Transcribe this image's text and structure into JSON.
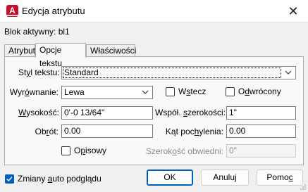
{
  "window": {
    "title": "Edycja atrybutu",
    "app_icon": "A",
    "close_icon": "close-icon"
  },
  "block_label": "Blok aktywny: bl1",
  "tabs": [
    {
      "label": "Atrybut",
      "active": false
    },
    {
      "label": "Opcje tekstu",
      "active": true
    },
    {
      "label": "Właściwości",
      "active": false
    }
  ],
  "text_options": {
    "style": {
      "label": "Styl tekstu:",
      "value": "Standard"
    },
    "alignment": {
      "label": "Wyrównanie:",
      "value": "Lewa"
    },
    "backwards": {
      "label": "Wstecz",
      "checked": false
    },
    "upside_down": {
      "label": "Odwrócony",
      "checked": false
    },
    "height": {
      "label": "Wysokość:",
      "value": "0'-0 13/64\""
    },
    "width_factor": {
      "label": "Współ. szerokości:",
      "value": "1\""
    },
    "rotation": {
      "label": "Obrót:",
      "value": "0.00"
    },
    "oblique_angle": {
      "label": "Kąt pochylenia:",
      "value": "0.00"
    },
    "annotative": {
      "label": "Opisowy",
      "checked": false
    },
    "boundary_width": {
      "label": "Szerokość obwiedni:",
      "value": "0\""
    }
  },
  "footer": {
    "auto_preview": {
      "label": "Zmiany auto podglądu",
      "checked": true
    },
    "ok_label": "OK",
    "cancel_label": "Anuluj",
    "help_label": "Pomoc"
  },
  "colors": {
    "accent": "#005fb8",
    "app_icon_bg": "#c8102e"
  }
}
